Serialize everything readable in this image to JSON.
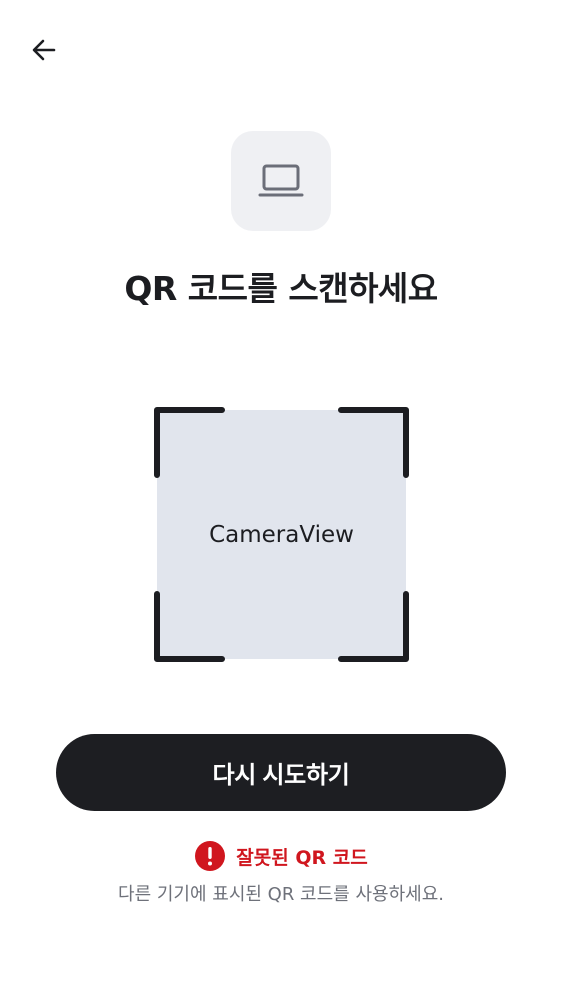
{
  "header": {
    "back_icon": "arrow-left-icon"
  },
  "device": {
    "icon": "laptop-icon",
    "tile_color": "#eff0f3"
  },
  "title": "QR 코드를 스캔하세요",
  "scanner": {
    "camera_label": "CameraView",
    "camera_bg": "#e1e5ed",
    "frame_color": "#1c1d21"
  },
  "actions": {
    "retry_label": "다시 시도하기"
  },
  "error": {
    "icon": "exclamation-circle-icon",
    "title": "잘못된 QR 코드",
    "description": "다른 기기에 표시된 QR 코드를 사용하세요.",
    "color": "#d0161e"
  }
}
